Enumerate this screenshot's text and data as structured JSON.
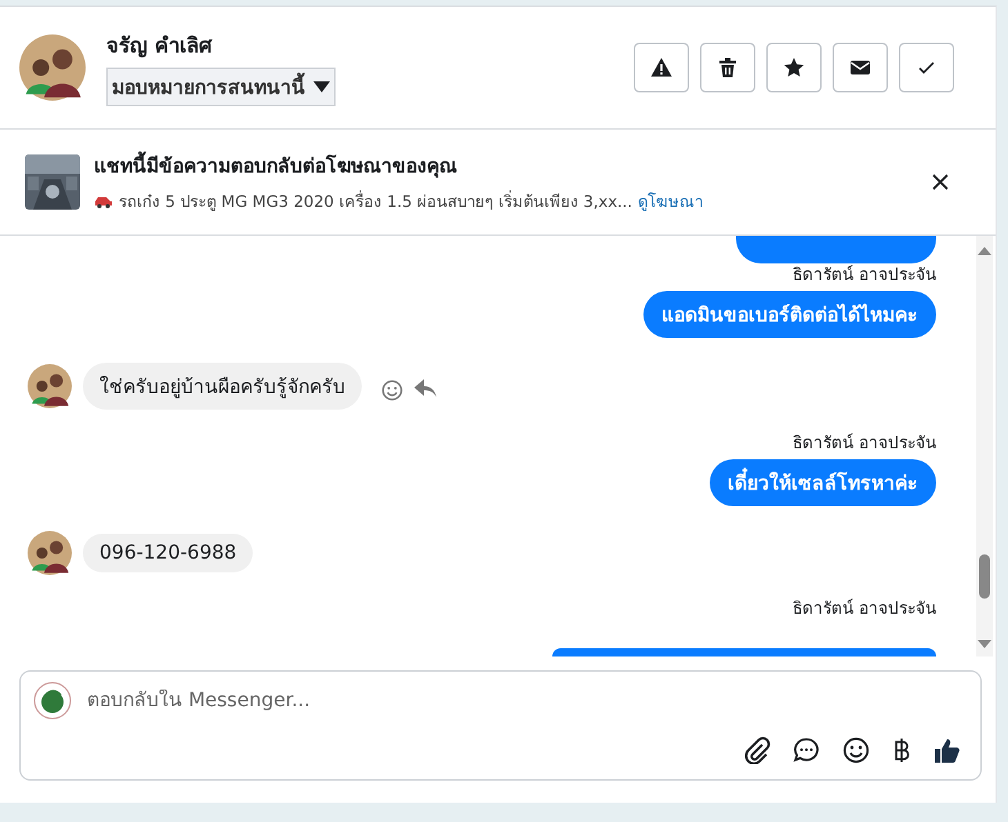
{
  "contact": {
    "name": "จรัญ คำเลิศ",
    "assign": "มอบหมายการสนทนานี้"
  },
  "actions": [
    {
      "kind": "warning"
    },
    {
      "kind": "trash"
    },
    {
      "kind": "star"
    },
    {
      "kind": "mail"
    },
    {
      "kind": "check"
    }
  ],
  "ad": {
    "title": "แชทนี้มีข้อความตอบกลับต่อโฆษณาของคุณ",
    "description": "รถเก๋ง 5 ประตู MG MG3 2020 เครื่อง 1.5 ผ่อนสบายๆ เริ่มต้นเพียง 3,xx...",
    "link": "ดูโฆษณา"
  },
  "messages": [
    {
      "kind": "cut-above"
    },
    {
      "kind": "sender",
      "text": "ธิดารัตน์ อาจประจัน"
    },
    {
      "kind": "outgoing",
      "text": "แอดมินขอเบอร์ติดต่อได้ไหมคะ"
    },
    {
      "kind": "incoming",
      "text": "ใช่ครับอยู่บ้านผือครับรู้จักครับ",
      "reactions": true
    },
    {
      "kind": "sender",
      "text": "ธิดารัตน์ อาจประจัน"
    },
    {
      "kind": "outgoing",
      "text": "เดี๋ยวให้เซลล์โทรหาค่ะ"
    },
    {
      "kind": "incoming",
      "text": "096-120-6988",
      "reactions": false
    },
    {
      "kind": "sender",
      "text": "ธิดารัตน์ อาจประจัน"
    },
    {
      "kind": "cut-below"
    }
  ],
  "composer": {
    "placeholder": "ตอบกลับใน Messenger...",
    "tools": [
      {
        "kind": "attach"
      },
      {
        "kind": "chat"
      },
      {
        "kind": "emoji"
      },
      {
        "kind": "baht"
      },
      {
        "kind": "like"
      }
    ]
  }
}
